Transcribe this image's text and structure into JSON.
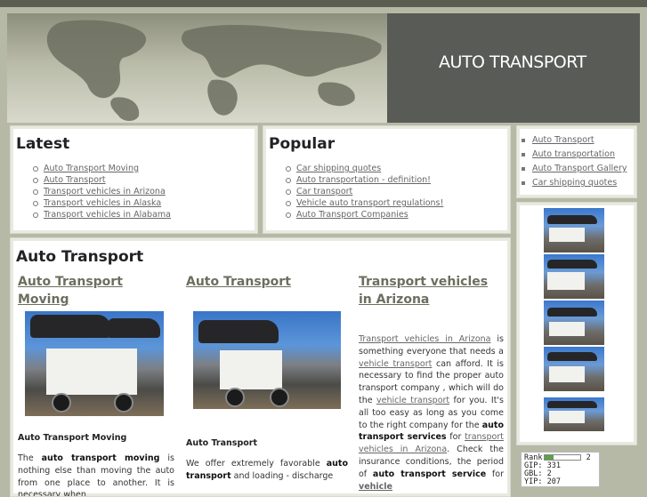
{
  "header": {
    "site_title": "AUTO TRANSPORT"
  },
  "latest": {
    "heading": "Latest",
    "items": [
      "Auto Transport Moving",
      "Auto Transport",
      "Transport vehicles in Arizona",
      "Transport vehicles in Alaska",
      "Transport vehicles in Alabama"
    ]
  },
  "popular": {
    "heading": "Popular",
    "items": [
      "Car shipping quotes",
      "Auto transportation - definition!",
      "Car transport",
      "Vehicle auto transport regulations!",
      "Auto Transport Companies"
    ]
  },
  "sidebar": {
    "links": [
      "Auto Transport",
      "Auto transportation",
      "Auto Transport Gallery",
      "Car shipping quotes"
    ]
  },
  "main": {
    "heading": "Auto Transport",
    "col1": {
      "title": "Auto Transport Moving",
      "caption": "Auto Transport Moving",
      "text_pre": "The ",
      "text_bold": "auto transport moving",
      "text_post": " is nothing else than moving the auto from one place to another. It is necessary when"
    },
    "col2": {
      "title": "Auto Transport",
      "caption": "Auto Transport",
      "text_pre": "We offer extremely favorable ",
      "text_bold1": "auto transport",
      "text_mid": " and loading - discharge"
    },
    "col3": {
      "title": "Transport vehicles in Arizona",
      "link1": "Transport vehicles in Arizona",
      "t1": " is something everyone that needs a ",
      "link2": "vehicle transport",
      "t2": " can afford. It is necessary to find the proper auto transport company , which will do the ",
      "link3": "vehicle transport",
      "t3": " for you. It's all too easy as long as you come to the right company for the ",
      "bold1": "auto transport services",
      "t4": " for ",
      "link4": "transport vehicles in Arizona",
      "t5": ". Check the insurance conditions, the period of ",
      "bold2": "auto transport service",
      "t6": " for ",
      "link5": "vehicle"
    }
  },
  "rank": {
    "rank_label": "Rank",
    "rank_value": "2",
    "rank_fraction": 0.25,
    "line1": "GIP: 331",
    "line2": "GBL: 2",
    "line3": "YIP: 207"
  }
}
